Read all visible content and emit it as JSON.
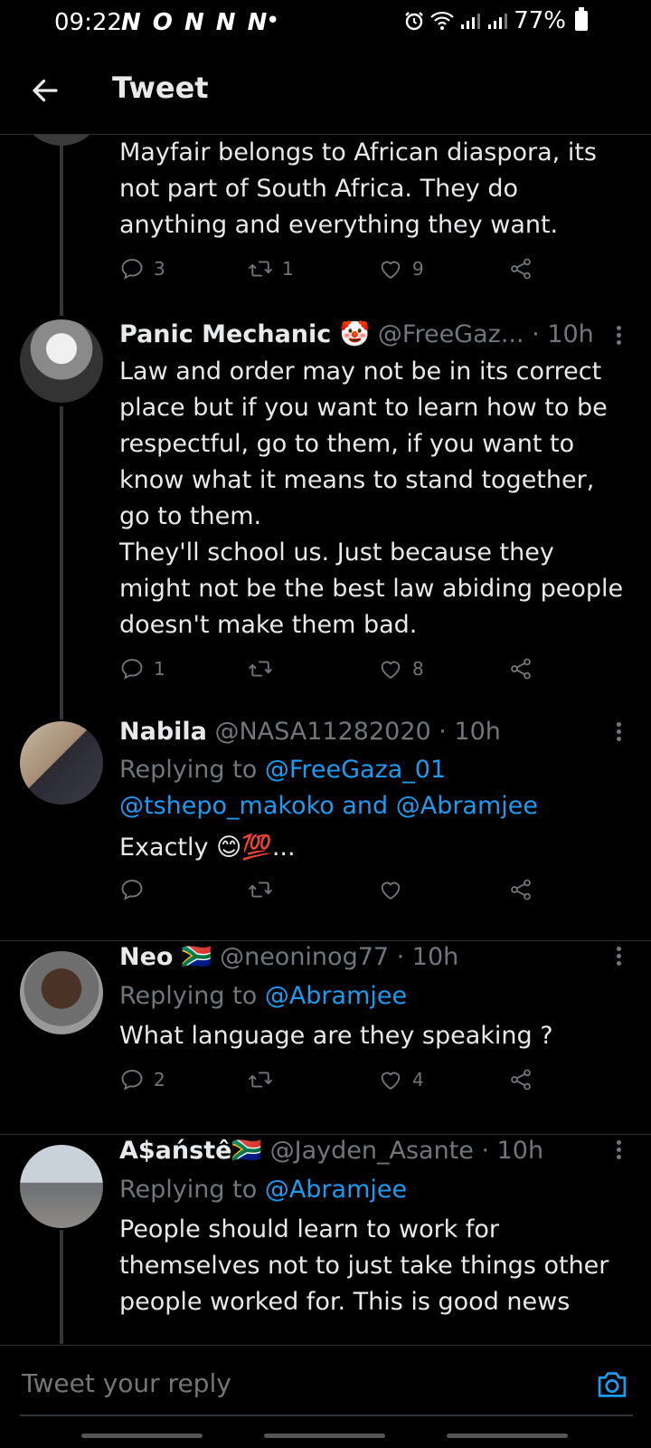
{
  "status": {
    "time": "09:22",
    "notification_icons": "N O N N N",
    "battery": "77%"
  },
  "header": {
    "title": "Tweet"
  },
  "tweets": [
    {
      "body": "Mayfair belongs to African diaspora, its not part of South Africa. They do anything and everything they want.",
      "replies": "3",
      "retweets": "1",
      "likes": "9"
    },
    {
      "name": "Panic Mechanic 🤡",
      "handle_time": "@FreeGaz... · 10h",
      "body": "Law and order may not be in its correct place but if you want to learn how to be respectful, go to them, if you want to know what it means to stand together, go to them.\nThey'll school us. Just because they might not be the best law abiding people doesn't make them bad.",
      "replies": "1",
      "retweets": "",
      "likes": "8"
    },
    {
      "name": "Nabila",
      "handle_time": "@NASA11282020 · 10h",
      "replying_prefix": "Replying to ",
      "replying_line1": "@FreeGaza_01",
      "replying_line2": "@tshepo_makoko and @Abramjee",
      "body": "Exactly 😊💯...",
      "replies": "",
      "retweets": "",
      "likes": ""
    },
    {
      "name": "Neo 🇿🇦",
      "handle_time": "@neoninog77 · 10h",
      "replying_prefix": "Replying to ",
      "replying_line1": "@Abramjee",
      "body": "What language are they speaking ?",
      "replies": "2",
      "retweets": "",
      "likes": "4"
    },
    {
      "name": "A$aństê🇿🇦",
      "handle_time": "@Jayden_Asante · 10h",
      "replying_prefix": "Replying to ",
      "replying_line1": "@Abramjee",
      "body": "People should learn to work for themselves not to just take things other people worked for. This is good news",
      "replies": "",
      "retweets": "",
      "likes": ""
    }
  ],
  "reply": {
    "placeholder": "Tweet your reply"
  },
  "colors": {
    "background": "#000000",
    "accent": "#1d9bf0",
    "muted": "#71767b"
  }
}
